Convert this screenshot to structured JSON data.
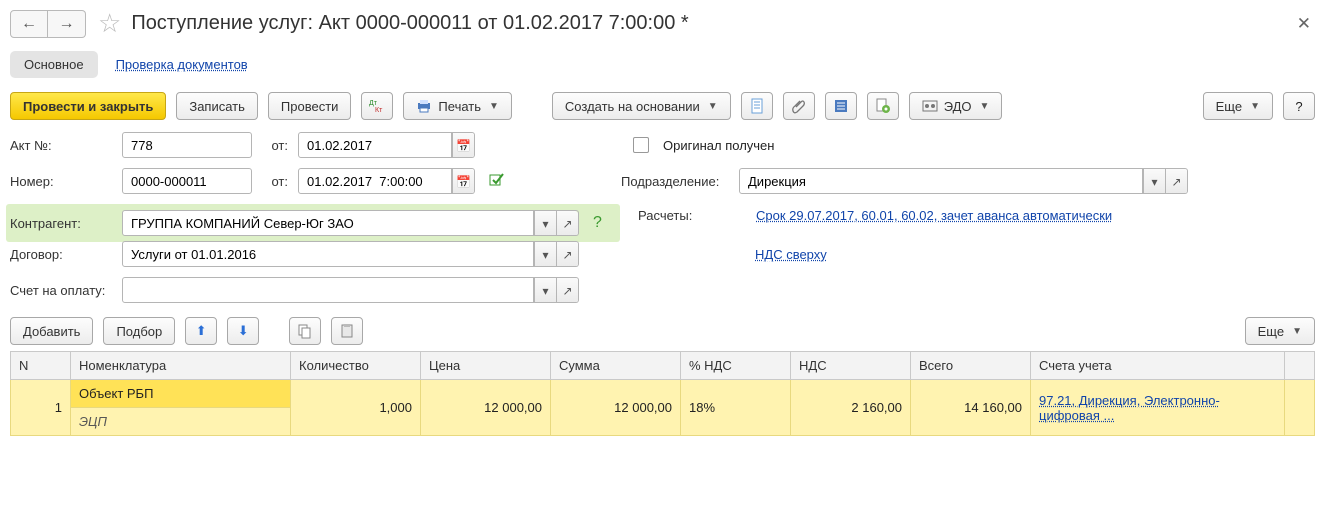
{
  "title": "Поступление услуг: Акт 0000-000011 от 01.02.2017 7:00:00 *",
  "tabs": {
    "main": "Основное",
    "check": "Проверка документов"
  },
  "toolbar": {
    "post_close": "Провести и закрыть",
    "save": "Записать",
    "post": "Провести",
    "print": "Печать",
    "create_based": "Создать на основании",
    "edo": "ЭДО",
    "more": "Еще"
  },
  "form": {
    "akt_no_label": "Акт №:",
    "akt_no": "778",
    "ot": "от:",
    "akt_date": "01.02.2017",
    "number_label": "Номер:",
    "number": "0000-000011",
    "number_date": "01.02.2017  7:00:00",
    "original_label": "Оригинал получен",
    "subdiv_label": "Подразделение:",
    "subdiv": "Дирекция",
    "counterparty_label": "Контрагент:",
    "counterparty": "ГРУППА КОМПАНИЙ Север-Юг ЗАО",
    "calc_label": "Расчеты:",
    "calc_link": "Срок 29.07.2017, 60.01, 60.02, зачет аванса автоматически",
    "contract_label": "Договор:",
    "contract": "Услуги от 01.01.2016",
    "vat_link": "НДС сверху",
    "invoice_label": "Счет на оплату:",
    "invoice": ""
  },
  "tbl_toolbar": {
    "add": "Добавить",
    "pick": "Подбор",
    "more": "Еще"
  },
  "tbl": {
    "headers": {
      "n": "N",
      "nom": "Номенклатура",
      "qty": "Количество",
      "price": "Цена",
      "sum": "Сумма",
      "vatp": "% НДС",
      "vat": "НДС",
      "total": "Всего",
      "acct": "Счета учета"
    },
    "row": {
      "n": "1",
      "nom1": "Объект РБП",
      "nom2": "ЭЦП",
      "qty": "1,000",
      "price": "12 000,00",
      "sum": "12 000,00",
      "vatp": "18%",
      "vat": "2 160,00",
      "total": "14 160,00",
      "acct": "97.21, Дирекция, Электронно-цифровая ..."
    }
  }
}
